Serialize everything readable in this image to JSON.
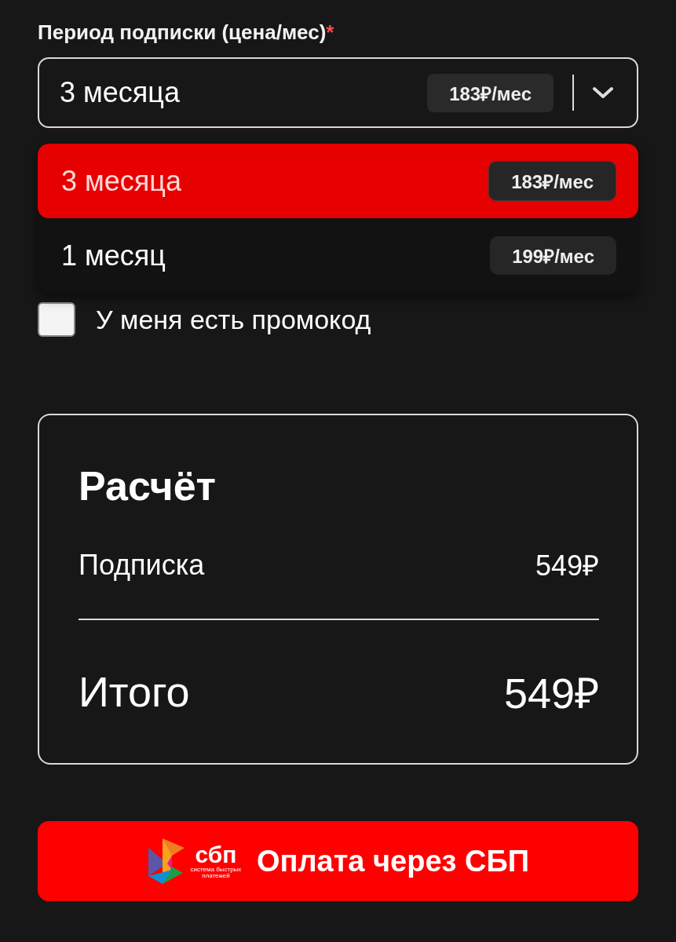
{
  "period_field": {
    "label": "Период подписки (цена/мес)",
    "required_mark": "*",
    "value": "3 месяца",
    "price_badge": "183₽/мес",
    "expanded": true
  },
  "options": [
    {
      "label": "3 месяца",
      "price": "183₽/мес",
      "selected": true
    },
    {
      "label": "1 месяц",
      "price": "199₽/мес",
      "selected": false
    }
  ],
  "promo_checkbox": {
    "label": "У меня есть промокод",
    "checked": false
  },
  "summary": {
    "title": "Расчёт",
    "rows": [
      {
        "label": "Подписка",
        "value": "549₽"
      }
    ],
    "total": {
      "label": "Итого",
      "value": "549₽"
    }
  },
  "pay_button": {
    "label": "Оплата через СБП",
    "logo_name": "сбп",
    "logo_caption": "система быстрых платежей"
  }
}
